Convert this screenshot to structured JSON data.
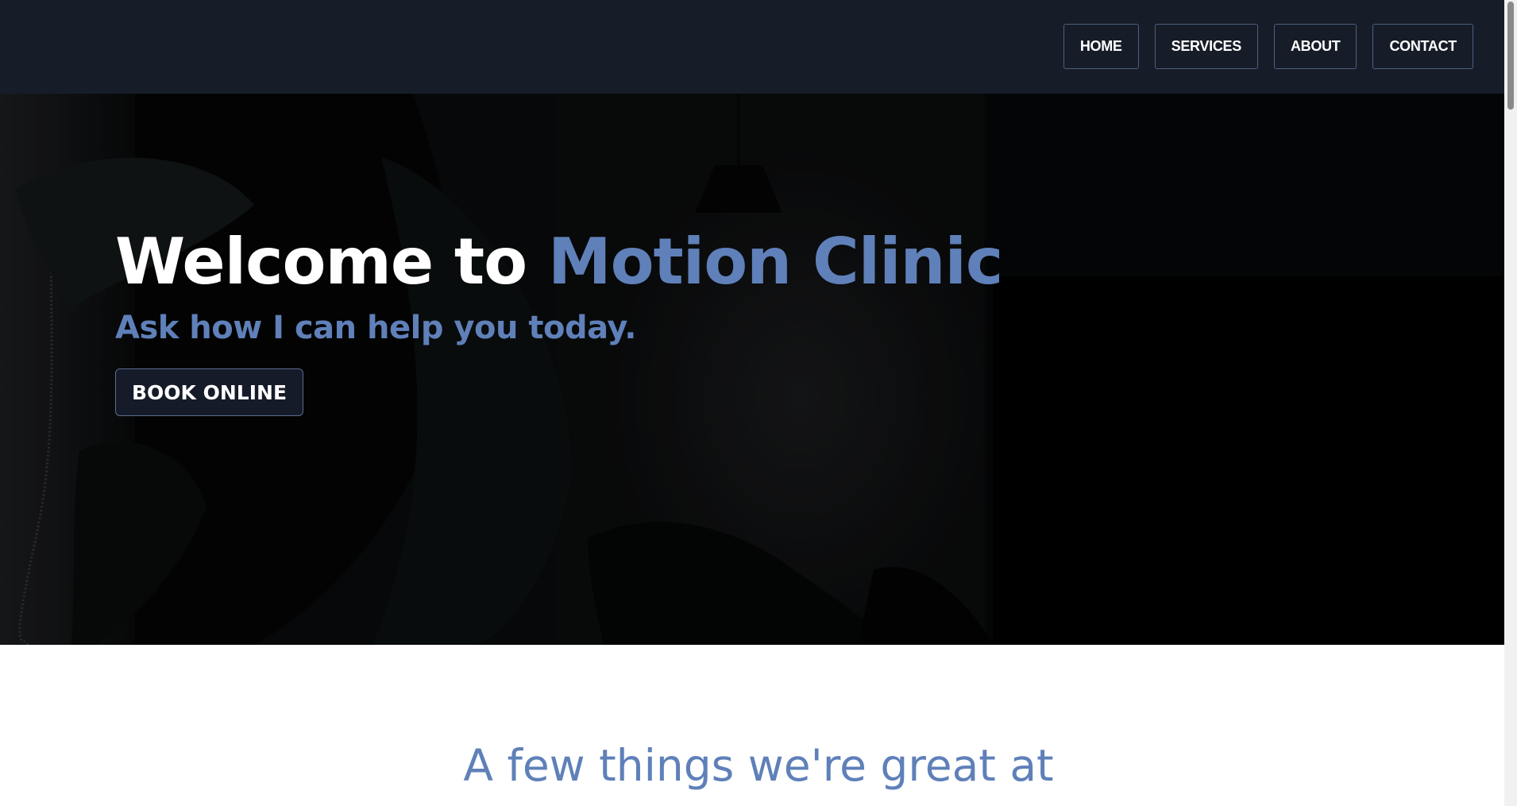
{
  "nav": {
    "items": [
      {
        "label": "HOME"
      },
      {
        "label": "SERVICES"
      },
      {
        "label": "ABOUT"
      },
      {
        "label": "CONTACT"
      }
    ]
  },
  "hero": {
    "title_prefix": "Welcome to ",
    "title_accent": "Motion Clinic",
    "subtitle": "Ask how I can help you today.",
    "cta_label": "BOOK ONLINE"
  },
  "features": {
    "heading": "A few things we're great at"
  },
  "colors": {
    "nav_background": "#161d28",
    "accent": "#5f80b9",
    "button_background": "#151b28"
  }
}
